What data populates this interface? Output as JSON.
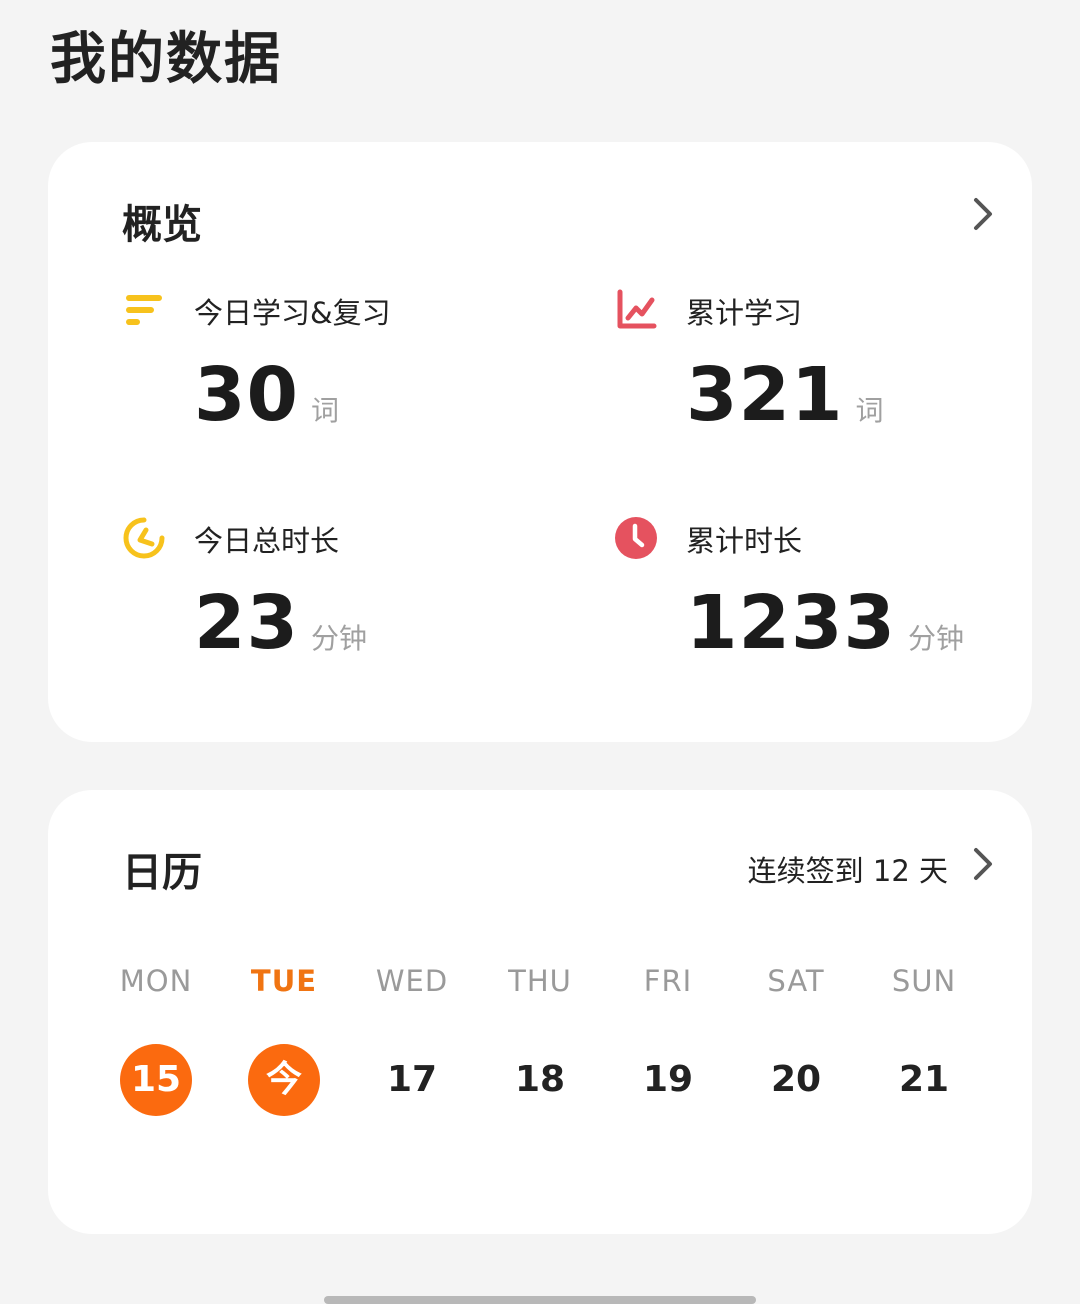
{
  "page": {
    "title": "我的数据"
  },
  "overview": {
    "title": "概览",
    "stats": [
      {
        "label": "今日学习&复习",
        "value": "30",
        "unit": "词",
        "icon": "bars-icon",
        "color": "#f7c21c"
      },
      {
        "label": "累计学习",
        "value": "321",
        "unit": "词",
        "icon": "line-chart-icon",
        "color": "#e5525f"
      },
      {
        "label": "今日总时长",
        "value": "23",
        "unit": "分钟",
        "icon": "timer-icon",
        "color": "#f7c21c"
      },
      {
        "label": "累计时长",
        "value": "1233",
        "unit": "分钟",
        "icon": "clock-icon",
        "color": "#e5525f"
      }
    ]
  },
  "calendar": {
    "title": "日历",
    "streak_text": "连续签到 12 天",
    "weekdays": [
      "MON",
      "TUE",
      "WED",
      "THU",
      "FRI",
      "SAT",
      "SUN"
    ],
    "dates": [
      "15",
      "今",
      "17",
      "18",
      "19",
      "20",
      "21"
    ],
    "accent": "#fb6a0f"
  }
}
